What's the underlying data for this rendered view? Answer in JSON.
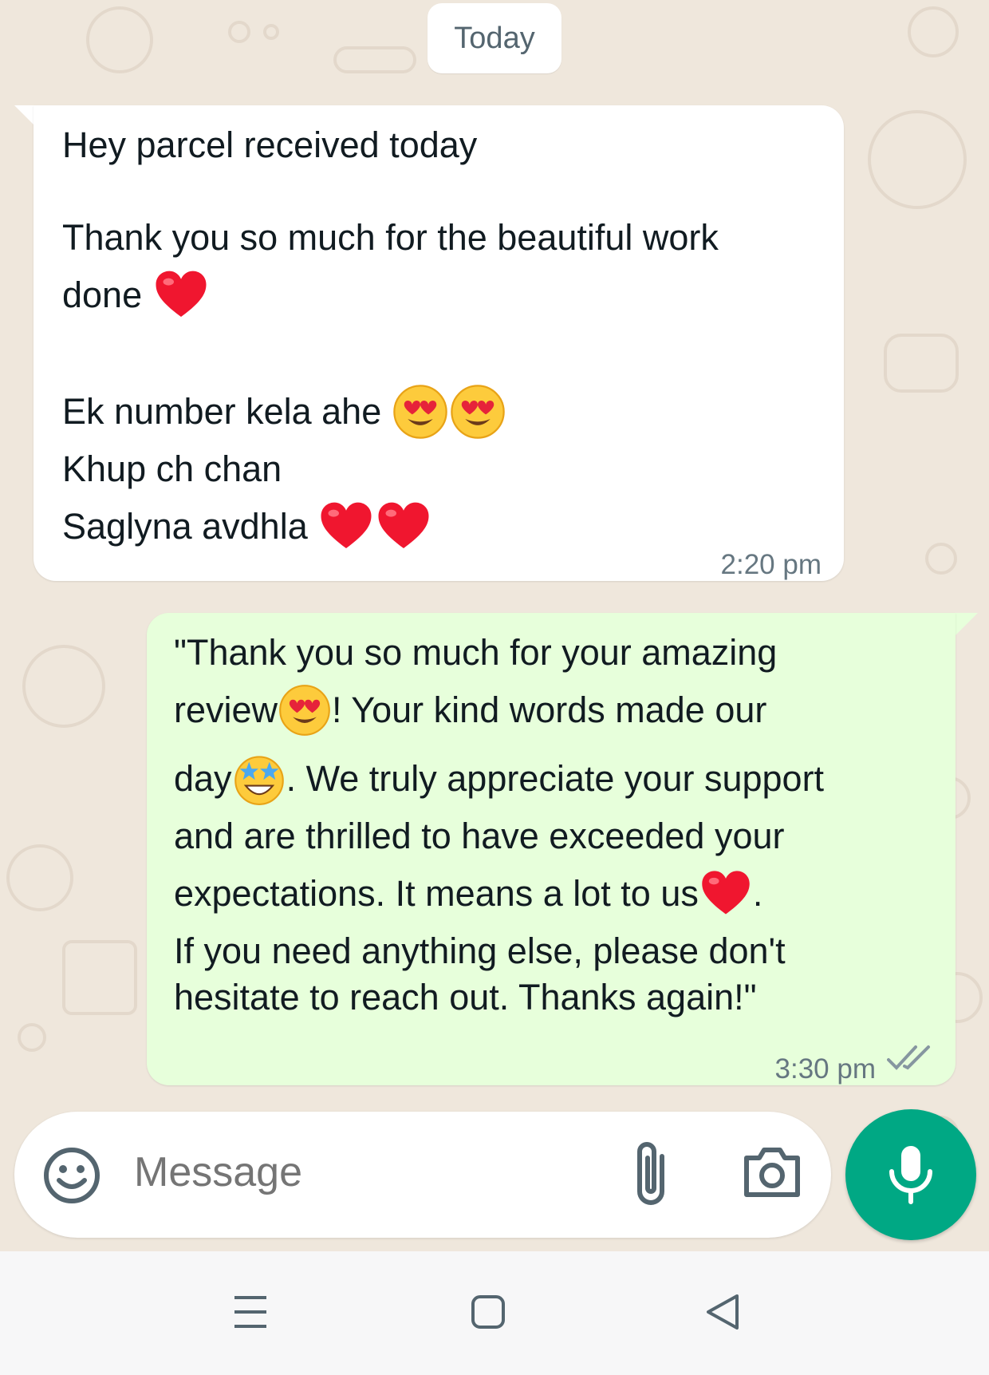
{
  "date_divider": "Today",
  "incoming_message": {
    "lines": [
      "Hey parcel received today",
      "Thank you so much for the beautiful work",
      "done",
      "Ek number kela ahe",
      "Khup ch chan",
      "Saglyna avdhla"
    ],
    "time": "2:20 pm"
  },
  "outgoing_message": {
    "lines": [
      "\"Thank you so much for your amazing",
      "review",
      "! Your kind words made our",
      "day",
      ". We truly appreciate your support",
      "and are thrilled to have exceeded your",
      "expectations. It means a lot to us",
      ".",
      "If you need anything else, please don't",
      "hesitate to reach out. Thanks again!\""
    ],
    "time": "3:30 pm",
    "status": "double-check-read-icon"
  },
  "composer": {
    "placeholder": "Message",
    "icons": [
      "emoji-icon",
      "attach-icon",
      "camera-icon",
      "microphone-icon"
    ]
  },
  "system_nav": {
    "icons": [
      "menu-icon",
      "home-icon",
      "back-icon"
    ]
  },
  "colors": {
    "background": "#efe7dc",
    "incoming_bubble": "#ffffff",
    "outgoing_bubble": "#e7ffdb",
    "accent": "#00a884",
    "meta_text": "#667781"
  }
}
